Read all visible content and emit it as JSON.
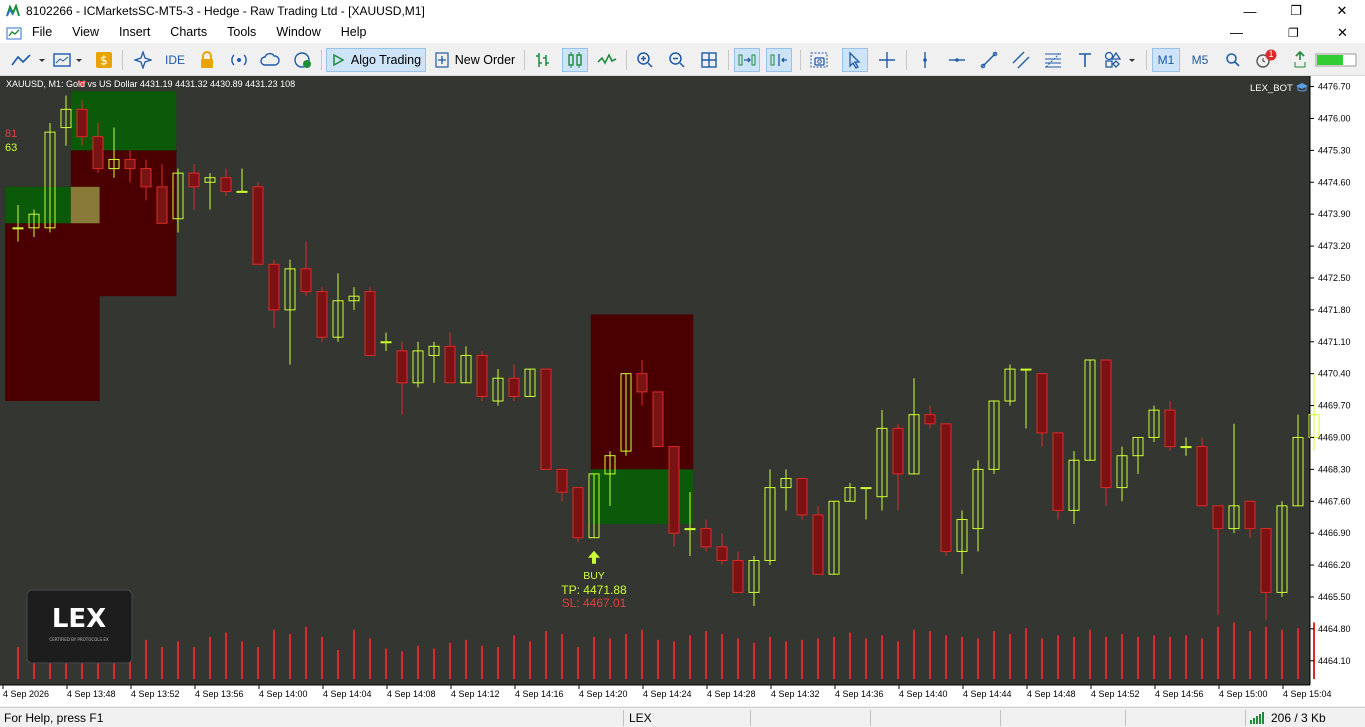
{
  "window": {
    "title": "8102266 - ICMarketsSC-MT5-3 - Hedge - Raw Trading Ltd - [XAUUSD,M1]",
    "minimize": "—",
    "maximize": "❐",
    "close": "✕"
  },
  "menu": [
    "File",
    "View",
    "Insert",
    "Charts",
    "Tools",
    "Window",
    "Help"
  ],
  "toolbar": {
    "ide_label": "IDE",
    "algo_trading_label": "Algo Trading",
    "new_order_label": "New Order",
    "tf_m1": "M1",
    "tf_m5": "M5",
    "notification_count": "1"
  },
  "colors": {
    "chart_bg": "#333631",
    "bull_candle": "#ccff33",
    "bear_candle": "#e02828",
    "volume": "#e02828",
    "zone_red": "#4a0000",
    "zone_green": "#0a5a0a",
    "axis_text": "#000000"
  },
  "chart": {
    "header": "XAUUSD, M1:  Gold vs US Dollar  4431.19 4431.32 4430.89 4431.23  108",
    "indicator_name": "LEX_BOT",
    "overlay_a": "81",
    "overlay_b": "63",
    "signal_label": "BUY",
    "tp_label": "TP: 4471.88",
    "sl_label": "SL: 4467.01",
    "logo_text": "LEX",
    "logo_subtext": "CERTIFIED BY PROTOCOLS EX"
  },
  "chart_data": {
    "type": "candlestick",
    "symbol": "XAUUSD",
    "timeframe": "M1",
    "y_ticks": [
      "4476.70",
      "4476.00",
      "4475.30",
      "4474.60",
      "4473.90",
      "4473.20",
      "4472.50",
      "4471.80",
      "4471.10",
      "4470.40",
      "4469.70",
      "4469.00",
      "4468.30",
      "4467.60",
      "4466.90",
      "4466.20",
      "4465.50",
      "4464.80",
      "4464.10"
    ],
    "ylim": [
      4463.7,
      4476.8
    ],
    "x_ticks": [
      "4 Sep 2026",
      "4 Sep 13:48",
      "4 Sep 13:52",
      "4 Sep 13:56",
      "4 Sep 14:00",
      "4 Sep 14:04",
      "4 Sep 14:08",
      "4 Sep 14:12",
      "4 Sep 14:16",
      "4 Sep 14:20",
      "4 Sep 14:24",
      "4 Sep 14:28",
      "4 Sep 14:32",
      "4 Sep 14:36",
      "4 Sep 14:40",
      "4 Sep 14:44",
      "4 Sep 14:48",
      "4 Sep 14:52",
      "4 Sep 14:56",
      "4 Sep 15:00",
      "4 Sep 15:04"
    ],
    "candles": [
      {
        "o": 4473.6,
        "h": 4474.1,
        "l": 4473.3,
        "c": 4473.6
      },
      {
        "o": 4473.6,
        "h": 4474.0,
        "l": 4473.4,
        "c": 4473.9
      },
      {
        "o": 4473.6,
        "h": 4475.9,
        "l": 4473.5,
        "c": 4475.7
      },
      {
        "o": 4475.8,
        "h": 4476.5,
        "l": 4475.4,
        "c": 4476.2
      },
      {
        "o": 4476.2,
        "h": 4476.4,
        "l": 4475.4,
        "c": 4475.6
      },
      {
        "o": 4475.6,
        "h": 4475.9,
        "l": 4474.8,
        "c": 4474.9
      },
      {
        "o": 4474.9,
        "h": 4475.8,
        "l": 4474.7,
        "c": 4475.1
      },
      {
        "o": 4475.1,
        "h": 4475.3,
        "l": 4474.6,
        "c": 4474.9
      },
      {
        "o": 4474.9,
        "h": 4475.1,
        "l": 4474.2,
        "c": 4474.5
      },
      {
        "o": 4474.5,
        "h": 4475.0,
        "l": 4473.7,
        "c": 4473.7
      },
      {
        "o": 4473.8,
        "h": 4474.9,
        "l": 4473.5,
        "c": 4474.8
      },
      {
        "o": 4474.8,
        "h": 4475.0,
        "l": 4474.0,
        "c": 4474.5
      },
      {
        "o": 4474.6,
        "h": 4474.8,
        "l": 4474.0,
        "c": 4474.7
      },
      {
        "o": 4474.7,
        "h": 4474.9,
        "l": 4474.3,
        "c": 4474.4
      },
      {
        "o": 4474.4,
        "h": 4474.9,
        "l": 4474.4,
        "c": 4474.4
      },
      {
        "o": 4474.5,
        "h": 4474.6,
        "l": 4472.8,
        "c": 4472.8
      },
      {
        "o": 4472.8,
        "h": 4472.9,
        "l": 4471.4,
        "c": 4471.8
      },
      {
        "o": 4471.8,
        "h": 4472.9,
        "l": 4470.6,
        "c": 4472.7
      },
      {
        "o": 4472.7,
        "h": 4473.3,
        "l": 4472.1,
        "c": 4472.2
      },
      {
        "o": 4472.2,
        "h": 4472.3,
        "l": 4471.1,
        "c": 4471.2
      },
      {
        "o": 4471.2,
        "h": 4472.6,
        "l": 4471.1,
        "c": 4472.0
      },
      {
        "o": 4472.0,
        "h": 4472.3,
        "l": 4471.8,
        "c": 4472.1
      },
      {
        "o": 4472.2,
        "h": 4472.3,
        "l": 4470.8,
        "c": 4470.8
      },
      {
        "o": 4471.1,
        "h": 4471.3,
        "l": 4470.9,
        "c": 4471.1
      },
      {
        "o": 4470.9,
        "h": 4471.1,
        "l": 4469.5,
        "c": 4470.2
      },
      {
        "o": 4470.2,
        "h": 4471.1,
        "l": 4470.1,
        "c": 4470.9
      },
      {
        "o": 4470.8,
        "h": 4471.1,
        "l": 4470.2,
        "c": 4471.0
      },
      {
        "o": 4471.0,
        "h": 4471.3,
        "l": 4470.2,
        "c": 4470.2
      },
      {
        "o": 4470.2,
        "h": 4471.0,
        "l": 4470.2,
        "c": 4470.8
      },
      {
        "o": 4470.8,
        "h": 4470.9,
        "l": 4469.8,
        "c": 4469.9
      },
      {
        "o": 4469.8,
        "h": 4470.5,
        "l": 4469.7,
        "c": 4470.3
      },
      {
        "o": 4470.3,
        "h": 4470.6,
        "l": 4469.8,
        "c": 4469.9
      },
      {
        "o": 4469.9,
        "h": 4470.5,
        "l": 4469.9,
        "c": 4470.5
      },
      {
        "o": 4470.5,
        "h": 4470.5,
        "l": 4468.3,
        "c": 4468.3
      },
      {
        "o": 4468.3,
        "h": 4468.3,
        "l": 4467.6,
        "c": 4467.8
      },
      {
        "o": 4467.9,
        "h": 4467.9,
        "l": 4466.7,
        "c": 4466.8
      },
      {
        "o": 4466.8,
        "h": 4468.2,
        "l": 4466.8,
        "c": 4468.2
      },
      {
        "o": 4468.2,
        "h": 4468.7,
        "l": 4467.5,
        "c": 4468.6
      },
      {
        "o": 4468.7,
        "h": 4470.4,
        "l": 4468.6,
        "c": 4470.4
      },
      {
        "o": 4470.4,
        "h": 4470.7,
        "l": 4469.7,
        "c": 4470.0
      },
      {
        "o": 4470.0,
        "h": 4470.0,
        "l": 4468.8,
        "c": 4468.8
      },
      {
        "o": 4468.8,
        "h": 4468.8,
        "l": 4466.6,
        "c": 4466.9
      },
      {
        "o": 4467.0,
        "h": 4467.8,
        "l": 4466.4,
        "c": 4467.0
      },
      {
        "o": 4467.0,
        "h": 4467.2,
        "l": 4466.5,
        "c": 4466.6
      },
      {
        "o": 4466.6,
        "h": 4466.9,
        "l": 4466.2,
        "c": 4466.3
      },
      {
        "o": 4466.3,
        "h": 4466.5,
        "l": 4465.6,
        "c": 4465.6
      },
      {
        "o": 4465.6,
        "h": 4466.4,
        "l": 4465.3,
        "c": 4466.3
      },
      {
        "o": 4466.3,
        "h": 4468.3,
        "l": 4466.2,
        "c": 4467.9
      },
      {
        "o": 4467.9,
        "h": 4468.3,
        "l": 4467.4,
        "c": 4468.1
      },
      {
        "o": 4468.1,
        "h": 4468.1,
        "l": 4467.2,
        "c": 4467.3
      },
      {
        "o": 4467.3,
        "h": 4467.5,
        "l": 4466.0,
        "c": 4466.0
      },
      {
        "o": 4466.0,
        "h": 4467.6,
        "l": 4466.0,
        "c": 4467.6
      },
      {
        "o": 4467.6,
        "h": 4468.0,
        "l": 4467.6,
        "c": 4467.9
      },
      {
        "o": 4467.9,
        "h": 4467.9,
        "l": 4467.2,
        "c": 4467.9
      },
      {
        "o": 4467.7,
        "h": 4469.6,
        "l": 4467.4,
        "c": 4469.2
      },
      {
        "o": 4469.2,
        "h": 4469.3,
        "l": 4467.4,
        "c": 4468.2
      },
      {
        "o": 4468.2,
        "h": 4470.3,
        "l": 4468.2,
        "c": 4469.5
      },
      {
        "o": 4469.5,
        "h": 4469.7,
        "l": 4469.2,
        "c": 4469.3
      },
      {
        "o": 4469.3,
        "h": 4469.3,
        "l": 4466.4,
        "c": 4466.5
      },
      {
        "o": 4466.5,
        "h": 4467.4,
        "l": 4466.0,
        "c": 4467.2
      },
      {
        "o": 4467.0,
        "h": 4468.5,
        "l": 4466.5,
        "c": 4468.3
      },
      {
        "o": 4468.3,
        "h": 4469.8,
        "l": 4468.2,
        "c": 4469.8
      },
      {
        "o": 4469.8,
        "h": 4470.6,
        "l": 4469.7,
        "c": 4470.5
      },
      {
        "o": 4470.5,
        "h": 4470.5,
        "l": 4469.2,
        "c": 4470.5
      },
      {
        "o": 4470.4,
        "h": 4470.4,
        "l": 4468.8,
        "c": 4469.1
      },
      {
        "o": 4469.1,
        "h": 4469.1,
        "l": 4467.2,
        "c": 4467.4
      },
      {
        "o": 4467.4,
        "h": 4468.7,
        "l": 4467.1,
        "c": 4468.5
      },
      {
        "o": 4468.5,
        "h": 4470.7,
        "l": 4468.5,
        "c": 4470.7
      },
      {
        "o": 4470.7,
        "h": 4470.7,
        "l": 4467.5,
        "c": 4467.9
      },
      {
        "o": 4467.9,
        "h": 4468.8,
        "l": 4467.6,
        "c": 4468.6
      },
      {
        "o": 4468.6,
        "h": 4469.0,
        "l": 4468.2,
        "c": 4469.0
      },
      {
        "o": 4469.0,
        "h": 4469.7,
        "l": 4468.9,
        "c": 4469.6
      },
      {
        "o": 4469.6,
        "h": 4469.8,
        "l": 4468.7,
        "c": 4468.8
      },
      {
        "o": 4468.8,
        "h": 4469.0,
        "l": 4468.6,
        "c": 4468.8
      },
      {
        "o": 4468.8,
        "h": 4469.0,
        "l": 4467.5,
        "c": 4467.5
      },
      {
        "o": 4467.5,
        "h": 4467.5,
        "l": 4465.1,
        "c": 4467.0
      },
      {
        "o": 4467.0,
        "h": 4469.3,
        "l": 4466.9,
        "c": 4467.5
      },
      {
        "o": 4467.6,
        "h": 4467.6,
        "l": 4466.8,
        "c": 4467.0
      },
      {
        "o": 4467.0,
        "h": 4467.0,
        "l": 4465.0,
        "c": 4465.6
      },
      {
        "o": 4465.6,
        "h": 4467.6,
        "l": 4465.5,
        "c": 4467.5
      },
      {
        "o": 4467.5,
        "h": 4469.5,
        "l": 4467.5,
        "c": 4469.0
      },
      {
        "o": 4469.0,
        "h": 4470.4,
        "l": 4468.7,
        "c": 4469.5
      }
    ],
    "volumes": [
      22,
      25,
      24,
      33,
      28,
      24,
      26,
      21,
      27,
      22,
      26,
      22,
      29,
      32,
      26,
      22,
      34,
      31,
      36,
      29,
      20,
      34,
      28,
      21,
      19,
      23,
      21,
      25,
      27,
      23,
      22,
      30,
      26,
      33,
      31,
      22,
      29,
      28,
      31,
      34,
      27,
      26,
      30,
      33,
      31,
      28,
      25,
      29,
      26,
      27,
      28,
      29,
      32,
      28,
      30,
      26,
      34,
      33,
      30,
      29,
      28,
      33,
      31,
      35,
      28,
      30,
      29,
      34,
      29,
      31,
      29,
      30,
      29,
      30,
      28,
      36,
      39,
      33,
      36,
      34,
      35,
      39
    ],
    "zones": [
      {
        "kind": "resistance",
        "x0": -0.8,
        "x1": 5.1,
        "y0": 4474.5,
        "y1": 4469.8
      },
      {
        "kind": "support",
        "x0": -0.8,
        "x1": 5.1,
        "y0": 4474.5,
        "y1": 4473.7
      },
      {
        "kind": "resistance",
        "x0": 3.3,
        "x1": 9.9,
        "y0": 4476.6,
        "y1": 4472.1
      },
      {
        "kind": "support",
        "x0": 3.3,
        "x1": 9.9,
        "y0": 4476.6,
        "y1": 4475.3
      },
      {
        "kind": "overlap",
        "x0": 3.3,
        "x1": 5.1,
        "y0": 4474.5,
        "y1": 4473.7
      },
      {
        "kind": "resistance",
        "x0": 35.8,
        "x1": 42.2,
        "y0": 4471.7,
        "y1": 4468.3
      },
      {
        "kind": "support",
        "x0": 35.8,
        "x1": 42.2,
        "y0": 4468.3,
        "y1": 4467.1
      }
    ],
    "signal": {
      "index": 36,
      "direction": "buy"
    },
    "marker_down_index": 4
  }
}
